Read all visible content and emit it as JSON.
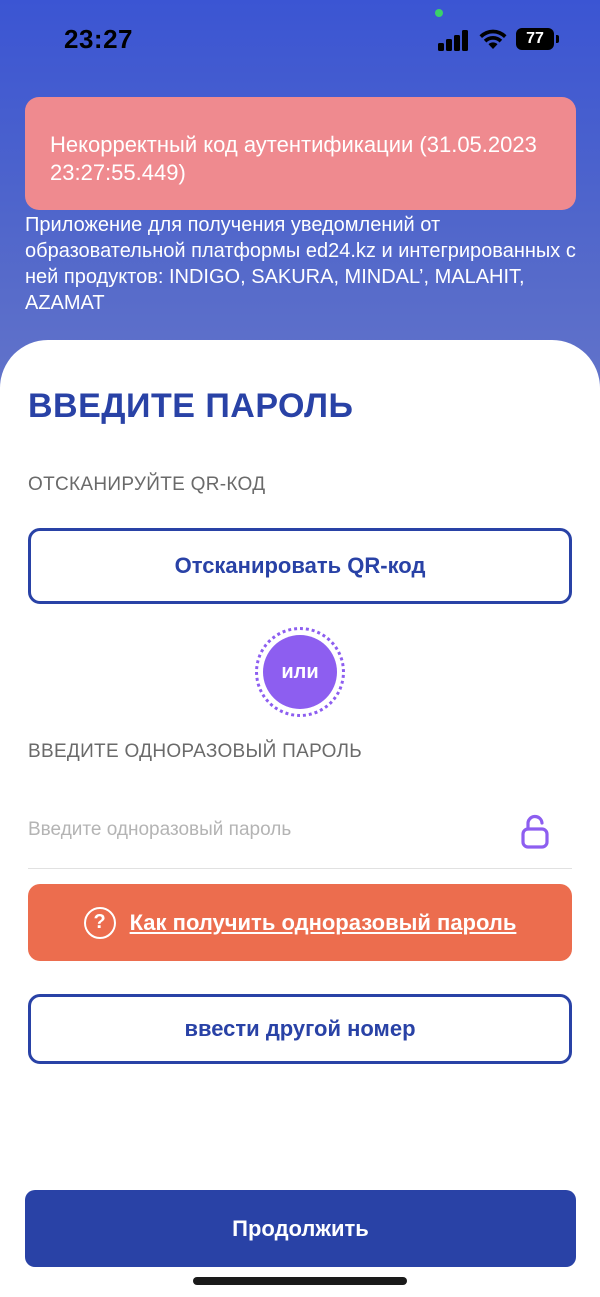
{
  "status_bar": {
    "time": "23:27",
    "battery_percent": "77",
    "battery_level": 0.77
  },
  "error_banner": {
    "text": "Некорректный код аутентификации (31.05.2023 23:27:55.449)"
  },
  "app_description": "Приложение для получения уведомлений от образовательной платформы ed24.kz и интегрированных с ней продуктов: INDIGO, SAKURA, MINDAL’, MALAHIT, AZAMAT",
  "main": {
    "title": "ВВЕДИТЕ ПАРОЛЬ",
    "qr_section_label": "ОТСКАНИРУЙТЕ QR-КОД",
    "scan_qr_button": "Отсканировать QR-код",
    "or_label": "или",
    "otp_section_label": "ВВЕДИТЕ ОДНОРАЗОВЫЙ ПАРОЛЬ",
    "otp_placeholder": "Введите одноразовый пароль",
    "otp_value": "",
    "help_button": "Как получить одноразовый пароль",
    "other_number_button": "ввести другой номер",
    "continue_button": "Продолжить"
  },
  "colors": {
    "primary": "#2942a6",
    "error_banner": "#ef8a8f",
    "help_button": "#ec6d4e",
    "accent_purple": "#8d5ef0"
  }
}
